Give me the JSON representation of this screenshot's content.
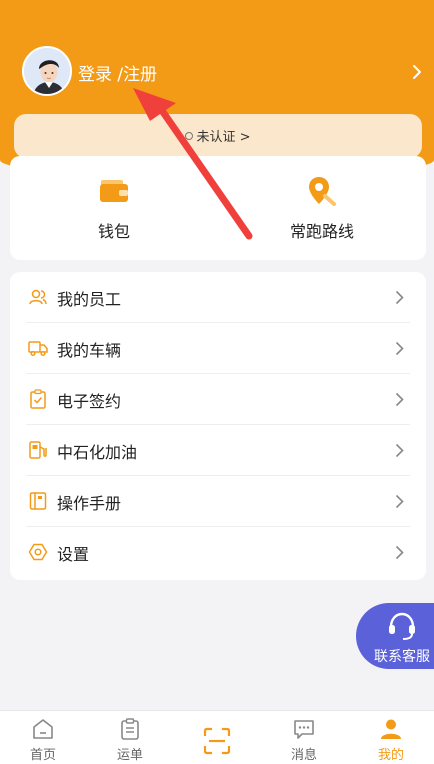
{
  "header": {
    "login_label": "登录 /注册",
    "auth_status": "未认证 >"
  },
  "quick_actions": [
    {
      "label": "钱包",
      "icon": "wallet-icon"
    },
    {
      "label": "常跑路线",
      "icon": "route-pin-icon"
    }
  ],
  "menu": [
    {
      "label": "我的员工",
      "icon": "employees-icon"
    },
    {
      "label": "我的车辆",
      "icon": "truck-icon"
    },
    {
      "label": "电子签约",
      "icon": "contract-icon"
    },
    {
      "label": "中石化加油",
      "icon": "fuel-icon"
    },
    {
      "label": "操作手册",
      "icon": "manual-icon"
    },
    {
      "label": "设置",
      "icon": "settings-icon"
    }
  ],
  "customer_service": {
    "label": "联系客服",
    "icon": "headset-icon"
  },
  "tabs": [
    {
      "label": "首页",
      "icon": "home-icon"
    },
    {
      "label": "运单",
      "icon": "waybill-icon"
    },
    {
      "label": "",
      "icon": "scan-icon"
    },
    {
      "label": "消息",
      "icon": "message-icon"
    },
    {
      "label": "我的",
      "icon": "profile-icon"
    }
  ],
  "colors": {
    "accent": "#f39b17",
    "service": "#5b61d8",
    "annotation_arrow": "#f0403c"
  }
}
